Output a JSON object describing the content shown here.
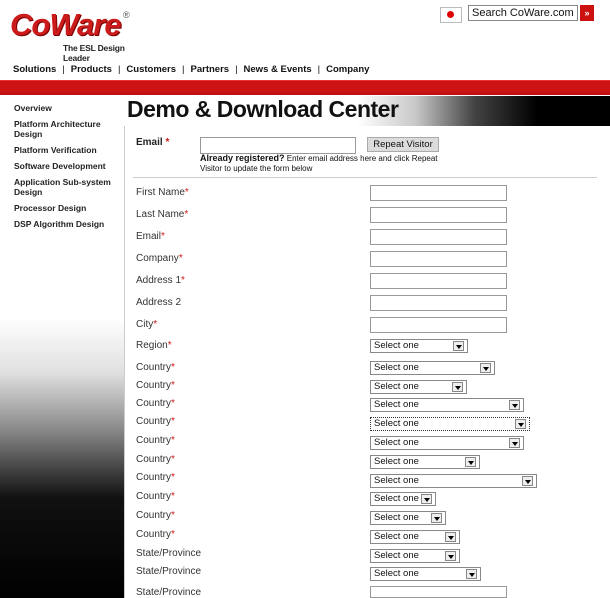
{
  "header": {
    "logo_text": "CoWare",
    "logo_reg": "®",
    "tagline": "The ESL Design Leader",
    "search_value": "Search CoWare.com",
    "search_go": "»"
  },
  "topnav": [
    "Solutions",
    "Products",
    "Customers",
    "Partners",
    "News & Events",
    "Company"
  ],
  "sidebar": [
    "Overview",
    "Platform Architecture Design",
    "Platform Verification",
    "Software Development",
    "Application Sub-system Design",
    "Processor Design",
    "DSP Algorithm Design"
  ],
  "page_title": "Demo & Download Center",
  "repeat": {
    "email_label": "Email",
    "required_mark": "*",
    "button_label": "Repeat Visitor",
    "help_bold": "Already registered?",
    "help_text": " Enter email address here and click Repeat Visitor to update the form below"
  },
  "fields": [
    {
      "label": "First Name",
      "req": "*"
    },
    {
      "label": "Last Name",
      "req": "*"
    },
    {
      "label": "Email",
      "req": "*"
    },
    {
      "label": "Company",
      "req": "*"
    },
    {
      "label": "Address 1",
      "req": "*"
    },
    {
      "label": "Address 2",
      "req": ""
    },
    {
      "label": "City",
      "req": "*"
    }
  ],
  "selects": [
    {
      "label": "Region",
      "req": "*",
      "value": "Select one"
    },
    {
      "label": "Country",
      "req": "*",
      "value": "Select one"
    },
    {
      "label": "Country",
      "req": "*",
      "value": "Select one"
    },
    {
      "label": "Country",
      "req": "*",
      "value": "Select one"
    },
    {
      "label": "Country",
      "req": "*",
      "value": "Select one"
    },
    {
      "label": "Country",
      "req": "*",
      "value": "Select one"
    },
    {
      "label": "Country",
      "req": "*",
      "value": "Select one"
    },
    {
      "label": "Country",
      "req": "*",
      "value": "Select one"
    },
    {
      "label": "Country",
      "req": "*",
      "value": "Select one"
    },
    {
      "label": "Country",
      "req": "*",
      "value": "Select one"
    },
    {
      "label": "Country",
      "req": "*",
      "value": "Select one"
    },
    {
      "label": "State/Province",
      "req": "",
      "value": "Select one"
    },
    {
      "label": "State/Province",
      "req": "",
      "value": "Select one"
    }
  ],
  "last_field": {
    "label": "State/Province",
    "req": ""
  }
}
